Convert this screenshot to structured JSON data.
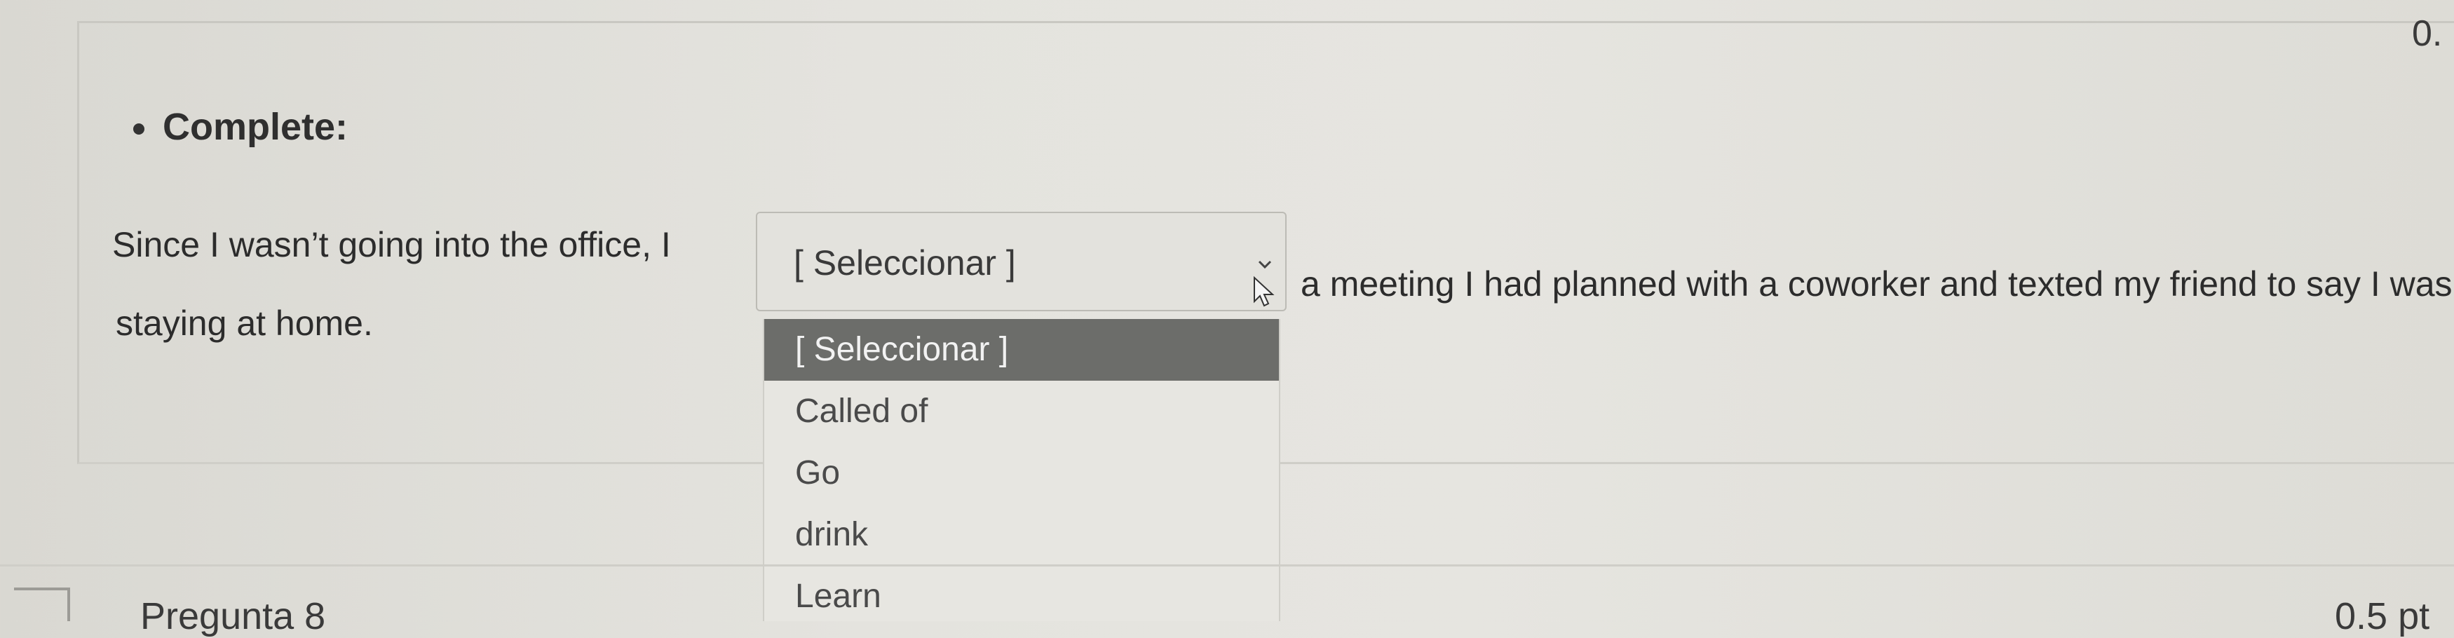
{
  "question": {
    "points": "0.",
    "heading": "Complete:",
    "sentence_start": "Since I wasn’t going into the office, I",
    "sentence_rest": "a meeting I had planned with a coworker and texted my friend to say I was",
    "sentence_line2": "staying at home.",
    "select": {
      "current_value": "[ Seleccionar ]",
      "options": [
        {
          "label": "[ Seleccionar ]",
          "selected": true
        },
        {
          "label": "Called of",
          "selected": false
        },
        {
          "label": "Go",
          "selected": false
        },
        {
          "label": "drink",
          "selected": false
        },
        {
          "label": "Learn",
          "selected": false
        }
      ]
    }
  },
  "next_question": {
    "title": "Pregunta 8",
    "points": "0.5 pt"
  },
  "colors": {
    "selected_option_bg": "#6c6d6a",
    "page_bg": "#e4e3de"
  },
  "icons": {
    "chevron": "chevron-down-icon",
    "cursor": "mouse-pointer-icon"
  }
}
